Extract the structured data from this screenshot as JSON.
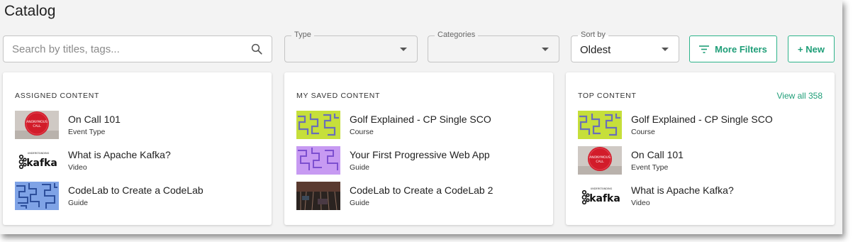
{
  "page": {
    "title": "Catalog"
  },
  "search": {
    "placeholder": "Search by titles, tags..."
  },
  "filters": {
    "type_label": "Type",
    "type_value": "",
    "categories_label": "Categories",
    "categories_value": "",
    "sort_label": "Sort by",
    "sort_value": "Oldest",
    "more_filters_label": "More Filters",
    "new_label": "+ New"
  },
  "colors": {
    "accent": "#1f9e78",
    "background": "#f3f3f3"
  },
  "cards": [
    {
      "heading": "ASSIGNED CONTENT",
      "items": [
        {
          "title": "On Call 101",
          "type": "Event Type",
          "thumb": "red-circle"
        },
        {
          "title": "What is Apache Kafka?",
          "type": "Video",
          "thumb": "kafka-logo"
        },
        {
          "title": "CodeLab to Create a CodeLab",
          "type": "Guide",
          "thumb": "blue-maze"
        }
      ]
    },
    {
      "heading": "MY SAVED CONTENT",
      "items": [
        {
          "title": "Golf Explained - CP Single SCO",
          "type": "Course",
          "thumb": "green-maze"
        },
        {
          "title": "Your First Progressive Web App",
          "type": "Guide",
          "thumb": "purple-maze"
        },
        {
          "title": "CodeLab to Create a CodeLab 2",
          "type": "Guide",
          "thumb": "dark-photo"
        }
      ]
    },
    {
      "heading": "TOP CONTENT",
      "view_all": "View all 358",
      "items": [
        {
          "title": "Golf Explained - CP Single SCO",
          "type": "Course",
          "thumb": "green-maze"
        },
        {
          "title": "On Call 101",
          "type": "Event Type",
          "thumb": "red-circle"
        },
        {
          "title": "What is Apache Kafka?",
          "type": "Video",
          "thumb": "kafka-logo"
        }
      ]
    }
  ]
}
